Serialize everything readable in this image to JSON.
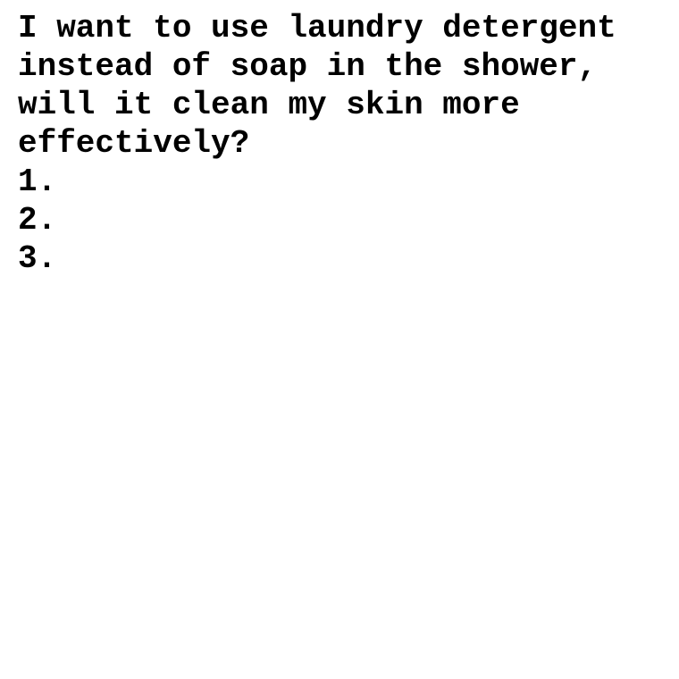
{
  "document": {
    "question": "I want to use laundry detergent instead of soap in the shower, will it clean my skin more effectively?",
    "items": [
      "1.",
      "2.",
      "3."
    ]
  },
  "colors": {
    "background": "#ffffff",
    "text": "#000000"
  }
}
